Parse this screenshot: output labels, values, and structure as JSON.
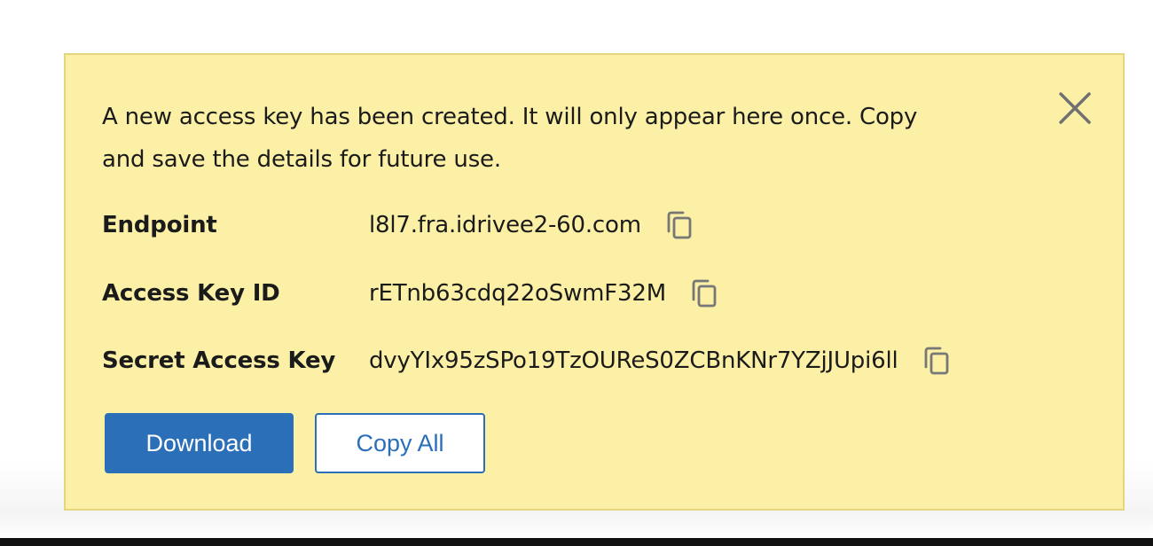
{
  "notice": {
    "message": "A new access key has been created. It will only appear here once. Copy and save the details for future use.",
    "close_icon": "close-icon",
    "fields": [
      {
        "label": "Endpoint",
        "value": "l8l7.fra.idrivee2-60.com",
        "icon": "copy-icon"
      },
      {
        "label": "Access Key ID",
        "value": "rETnb63cdq22oSwmF32M",
        "icon": "copy-icon"
      },
      {
        "label": "Secret Access Key",
        "value": "dvyYIx95zSPo19TzOUReS0ZCBnKNr7YZjJUpi6ll",
        "icon": "copy-icon"
      }
    ],
    "buttons": {
      "download_label": "Download",
      "copy_all_label": "Copy All"
    }
  },
  "colors": {
    "notice_background": "#fbf0a6",
    "notice_border": "#e4d680",
    "accent": "#2a6fb8",
    "text": "#1b1b1b",
    "icon": "#777777"
  }
}
